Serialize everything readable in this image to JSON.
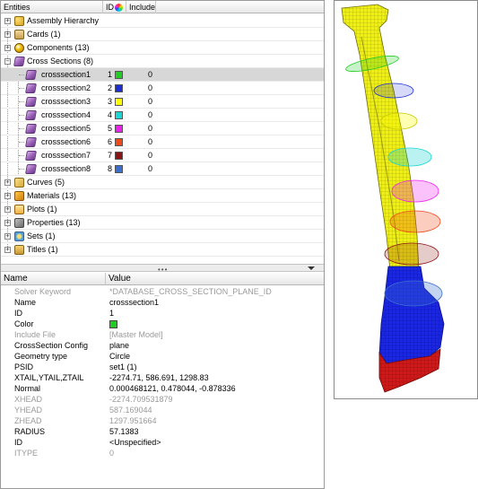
{
  "tree_header": {
    "entities_label": "Entities",
    "id_label": "ID",
    "include_label": "Include"
  },
  "tree": {
    "assembly": "Assembly Hierarchy",
    "cards": "Cards (1)",
    "components": "Components (13)",
    "cross_sections": "Cross Sections (8)",
    "curves": "Curves (5)",
    "materials": "Materials (13)",
    "plots": "Plots (1)",
    "properties": "Properties (13)",
    "sets": "Sets (1)",
    "titles": "Titles (1)"
  },
  "cross_sections": [
    {
      "name": "crosssection1",
      "id": "1",
      "color": "#22cc22",
      "include": "0"
    },
    {
      "name": "crosssection2",
      "id": "2",
      "color": "#1c2fd6",
      "include": "0"
    },
    {
      "name": "crosssection3",
      "id": "3",
      "color": "#ffff00",
      "include": "0"
    },
    {
      "name": "crosssection4",
      "id": "4",
      "color": "#1ad5d5",
      "include": "0"
    },
    {
      "name": "crosssection5",
      "id": "5",
      "color": "#ee22ee",
      "include": "0"
    },
    {
      "name": "crosssection6",
      "id": "6",
      "color": "#f04a1a",
      "include": "0"
    },
    {
      "name": "crosssection7",
      "id": "7",
      "color": "#8b1414",
      "include": "0"
    },
    {
      "name": "crosssection8",
      "id": "8",
      "color": "#3a6fd0",
      "include": "0"
    }
  ],
  "props_header": {
    "name_label": "Name",
    "value_label": "Value"
  },
  "properties": [
    {
      "name": "Solver Keyword",
      "value": "*DATABASE_CROSS_SECTION_PLANE_ID",
      "dim": true
    },
    {
      "name": "Name",
      "value": "crosssection1",
      "dim": false
    },
    {
      "name": "ID",
      "value": "1",
      "dim": false
    },
    {
      "name": "Color",
      "value": "",
      "dim": false
    },
    {
      "name": "Include File",
      "value": "[Master Model]",
      "dim": true
    },
    {
      "name": "CrossSection Config",
      "value": "plane",
      "dim": false
    },
    {
      "name": "Geometry type",
      "value": "Circle",
      "dim": false
    },
    {
      "name": "PSID",
      "value": "set1 (1)",
      "dim": false
    },
    {
      "name": "XTAIL,YTAIL,ZTAIL",
      "value": "-2274.71, 586.691, 1298.83",
      "dim": false
    },
    {
      "name": "Normal",
      "value": "0.000468121, 0.478044, -0.878336",
      "dim": false
    },
    {
      "name": "XHEAD",
      "value": "-2274.709531879",
      "dim": true
    },
    {
      "name": "YHEAD",
      "value": "587.169044",
      "dim": true
    },
    {
      "name": "ZHEAD",
      "value": "1297.951664",
      "dim": true
    },
    {
      "name": "RADIUS",
      "value": "57.1383",
      "dim": false
    },
    {
      "name": "ID",
      "value": "<Unspecified>",
      "dim": false
    },
    {
      "name": "ITYPE",
      "value": "0",
      "dim": true
    }
  ],
  "color_value": "#22cc22",
  "colors": {
    "mesh_yellow": "#eeee1a",
    "mesh_blue": "#1a26e0",
    "mesh_red": "#cc1a1a",
    "selection_gray": "#d7d7d7"
  }
}
